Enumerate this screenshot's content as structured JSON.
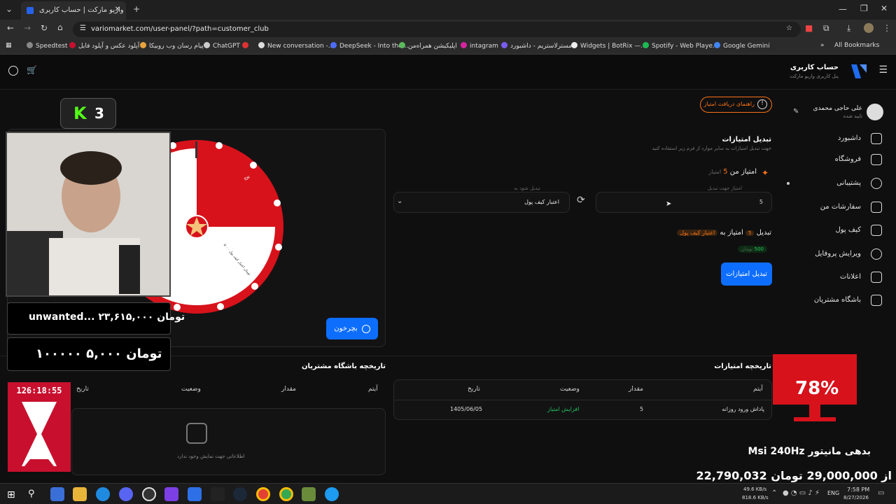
{
  "browser": {
    "tab_title": "واریو مارکت | حساب کاربری",
    "url": "variomarket.com/user-panel/?path=customer_club",
    "bookmarks": [
      "Speedtest",
      "آپلود عکس و آپلود فایل",
      "پیام رسان وب روبیکا",
      "ChatGPT",
      "New conversation -...",
      "DeepSeek - Into the...",
      "اپلیکیشن همراه‌من",
      "intagram",
      "مسترلاستریم - داشبورد",
      "Widgets | BotRix —...",
      "Spotify - Web Playe...",
      "Google Gemini"
    ],
    "all_bookmarks": "All Bookmarks"
  },
  "header": {
    "brand_title": "حساب کاربری",
    "brand_subtitle": "پنل کاربری واریو مارکت"
  },
  "user": {
    "name": "علی حاجی محمدی",
    "status": "تایید شده"
  },
  "sidebar": {
    "items": [
      {
        "label": "داشبورد"
      },
      {
        "label": "فروشگاه"
      },
      {
        "label": "پشتیبانی"
      },
      {
        "label": "سفارشات من"
      },
      {
        "label": "کیف پول"
      },
      {
        "label": "ویرایش پروفایل"
      },
      {
        "label": "اعلانات"
      },
      {
        "label": "باشگاه مشتریان"
      }
    ]
  },
  "points_guide_button": "راهنمای دریافت امتیاز",
  "exchange": {
    "title": "تبدیل امتیازات",
    "subtitle": "جهت تبدیل امتیازات به سایر موارد از فرم زیر استفاده کنید",
    "my_points_label": "امتیاز من",
    "my_points_value": "5",
    "my_points_unit": "امتیاز",
    "input_label": "امتیاز جهت تبدیل",
    "input_value": "5",
    "target_label": "تبدیل شود به",
    "target_value": "اعتبار کیف پول",
    "summary_prefix": "تبدیل",
    "summary_points": "5",
    "summary_mid": "امتیاز به",
    "summary_target": "اعتبار کیف پول",
    "summary_amount": "500",
    "summary_unit": "تومان",
    "submit": "تبدیل امتیازات"
  },
  "spin_button": "بچرخون",
  "wheel": {
    "slice1": "۵۰۰۰ تومان اعتبار کیف پول",
    "slice2": "پوچ"
  },
  "points_history": {
    "title": "تاریخچه امتیازات",
    "columns": [
      "آیتم",
      "مقدار",
      "وضعیت",
      "تاریخ"
    ],
    "rows": [
      {
        "item": "پاداش ورود روزانه",
        "amount": "5",
        "status": "افزایش امتیاز",
        "date": "1405/06/05"
      }
    ]
  },
  "club_history": {
    "title": "تاریخچه باشگاه مشتریان",
    "columns": [
      "آیتم",
      "مقدار",
      "وضعیت",
      "تاریخ"
    ],
    "empty": "اطلاعاتی جهت نمایش وجود ندارد"
  },
  "overlay": {
    "kick_count": "3",
    "donation1": "unwanted... ۲۳,۶۱۵,۰۰۰ تومان",
    "donation2": "۱۰۰۰۰۰ ۵,۰۰۰ تومان",
    "timer": "126:18:55",
    "goal_percent": "78%",
    "goal_title": "Msi 240Hz بدهی مانیتور",
    "goal_amount": "22,790,032 از 29,000,000 تومان"
  },
  "taskbar": {
    "net_up": "49.6 KB/s",
    "net_down": "818.6 KB/s",
    "lang": "ENG",
    "time": "7:58 PM",
    "date": "8/27/2026"
  },
  "colors": {
    "accent": "#0d6efd",
    "orange": "#f97316",
    "green": "#22c55e",
    "wheel_red": "#d7121b"
  }
}
